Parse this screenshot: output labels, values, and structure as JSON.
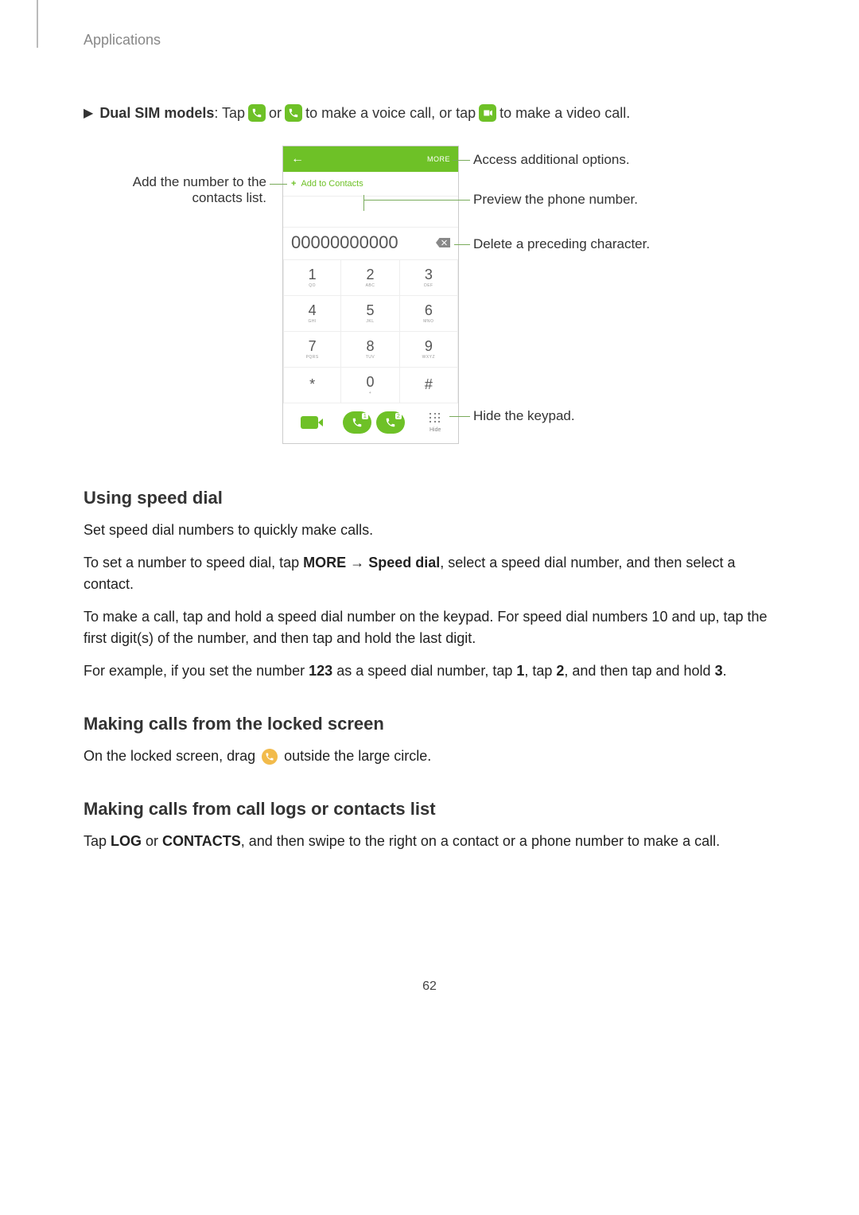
{
  "header": {
    "label": "Applications"
  },
  "intro": {
    "prefix_bold": "Dual SIM models",
    "text_tap": ": Tap ",
    "text_or": " or ",
    "text_voice": " to make a voice call, or tap ",
    "text_video": " to make a video call."
  },
  "callouts": {
    "left_add": "Add the number to the contacts list.",
    "right_more": "Access additional options.",
    "right_preview": "Preview the phone number.",
    "right_delete": "Delete a preceding character.",
    "right_hide": "Hide the keypad."
  },
  "phone": {
    "more": "MORE",
    "add_to_contacts": "Add to Contacts",
    "digits": "00000000000",
    "keys": [
      {
        "d": "1",
        "s": "QO"
      },
      {
        "d": "2",
        "s": "ABC"
      },
      {
        "d": "3",
        "s": "DEF"
      },
      {
        "d": "4",
        "s": "GHI"
      },
      {
        "d": "5",
        "s": "JKL"
      },
      {
        "d": "6",
        "s": "MNO"
      },
      {
        "d": "7",
        "s": "PQRS"
      },
      {
        "d": "8",
        "s": "TUV"
      },
      {
        "d": "9",
        "s": "WXYZ"
      },
      {
        "d": "*",
        "s": ""
      },
      {
        "d": "0",
        "s": "+"
      },
      {
        "d": "#",
        "s": ""
      }
    ],
    "call_badge_1": "1",
    "call_badge_2": "2",
    "hide_label": "Hide"
  },
  "sections": {
    "speed_dial": {
      "title": "Using speed dial",
      "p1": "Set speed dial numbers to quickly make calls.",
      "p2_pre": "To set a number to speed dial, tap ",
      "p2_more": "MORE",
      "p2_arrow": " → ",
      "p2_sd": "Speed dial",
      "p2_post": ", select a speed dial number, and then select a contact.",
      "p3": "To make a call, tap and hold a speed dial number on the keypad. For speed dial numbers 10 and up, tap the first digit(s) of the number, and then tap and hold the last digit.",
      "p4_pre": "For example, if you set the number ",
      "p4_123": "123",
      "p4_mid": " as a speed dial number, tap ",
      "p4_1": "1",
      "p4_tap": ", tap ",
      "p4_2": "2",
      "p4_hold": ", and then tap and hold ",
      "p4_3": "3",
      "p4_end": "."
    },
    "locked_screen": {
      "title": "Making calls from the locked screen",
      "p_pre": "On the locked screen, drag ",
      "p_post": " outside the large circle."
    },
    "call_logs": {
      "title": "Making calls from call logs or contacts list",
      "p_pre": "Tap ",
      "p_log": "LOG",
      "p_or": " or ",
      "p_contacts": "CONTACTS",
      "p_post": ", and then swipe to the right on a contact or a phone number to make a call."
    }
  },
  "page_number": "62"
}
